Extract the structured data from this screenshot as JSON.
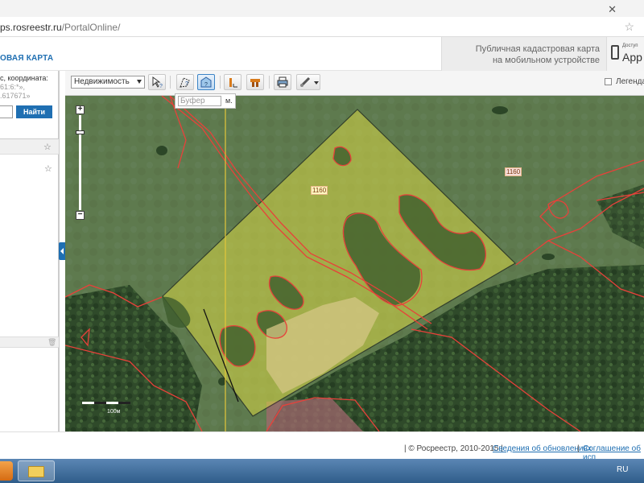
{
  "browser": {
    "url_host": "ps.rosreestr.ru",
    "url_path": "/PortalOnline/"
  },
  "header": {
    "title": "ОВАЯ КАРТА",
    "mobile_line1": "Публичная кадастровая карта",
    "mobile_line2": "на мобильном устройстве",
    "appstore_small": "Доступ",
    "appstore_big": "App"
  },
  "left_panel": {
    "hint_line1": "с, координата:",
    "hint_line2": "61:6:*»,",
    "hint_line3": ".617671»",
    "search_button": "Найти"
  },
  "toolbar": {
    "layer_select": "Недвижимость",
    "legend_label": "Легенда"
  },
  "buffer": {
    "placeholder": "Буфер",
    "unit": "м."
  },
  "map": {
    "parcel_label": "1160",
    "parcel_label_2": "1160",
    "scale_label": "100м",
    "highlight_color": "#d8d845",
    "boundary_color": "#e8413a"
  },
  "footer": {
    "copyright": "| © Росреестр, 2010-2015 |",
    "link_updates": "Сведения об обновлениях",
    "link_agreement": "Соглашение об исп"
  },
  "taskbar": {
    "language": "RU"
  }
}
